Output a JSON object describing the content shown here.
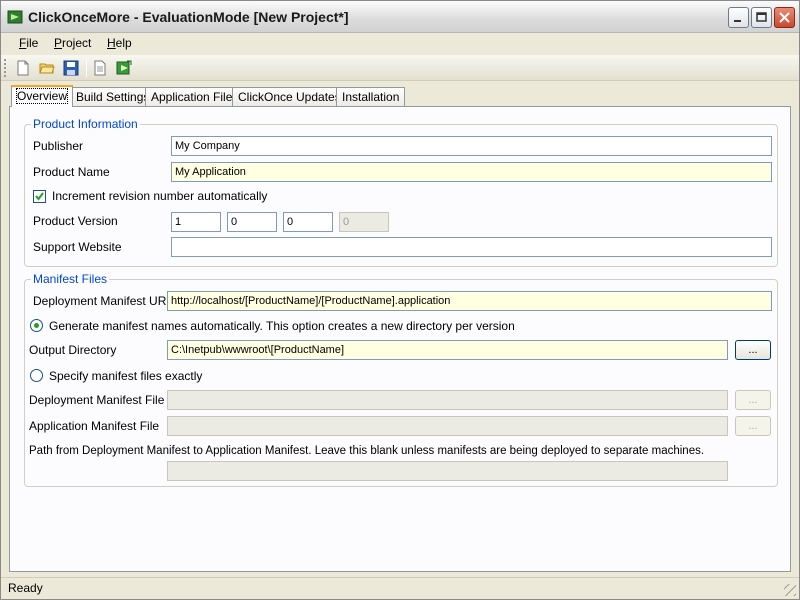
{
  "window": {
    "title": "ClickOnceMore - EvaluationMode [New Project*]",
    "icons": {
      "app": "clickonce-app-icon",
      "minimize": "minimize-icon",
      "maximize": "maximize-icon",
      "close": "close-icon"
    }
  },
  "menu": {
    "items": [
      {
        "label": "File",
        "accel": "F",
        "rest": "ile"
      },
      {
        "label": "Project",
        "accel": "P",
        "rest": "roject"
      },
      {
        "label": "Help",
        "accel": "H",
        "rest": "elp"
      }
    ]
  },
  "toolbar": {
    "icons": [
      "new-document-icon",
      "open-folder-icon",
      "save-icon",
      "page-icon",
      "build-publish-icon"
    ]
  },
  "tabs": [
    {
      "label": "Overview",
      "active": true
    },
    {
      "label": "Build Settings",
      "active": false
    },
    {
      "label": "Application Files",
      "active": false
    },
    {
      "label": "ClickOnce Updates",
      "active": false
    },
    {
      "label": "Installation",
      "active": false
    }
  ],
  "product_info": {
    "title": "Product Information",
    "publisher_label": "Publisher",
    "publisher_value": "My Company",
    "product_name_label": "Product Name",
    "product_name_value": "My Application",
    "increment_label": "Increment revision number automatically",
    "increment_checked": true,
    "version_label": "Product Version",
    "version": {
      "major": "1",
      "minor": "0",
      "build": "0",
      "revision": "0"
    },
    "support_label": "Support Website",
    "support_value": ""
  },
  "manifest": {
    "title": "Manifest Files",
    "deploy_url_label": "Deployment Manifest URL",
    "deploy_url_value": "http://localhost/[ProductName]/[ProductName].application",
    "auto_label": "Generate manifest names automatically. This option creates a new directory per version",
    "auto_selected": true,
    "output_label": "Output Directory",
    "output_value": "C:\\Inetpub\\wwwroot\\[ProductName]",
    "browse_label": "...",
    "exact_label": "Specify manifest files exactly",
    "exact_selected": false,
    "deploy_file_label": "Deployment Manifest File",
    "deploy_file_value": "",
    "app_file_label": "Application Manifest File",
    "app_file_value": "",
    "path_label": "Path from Deployment Manifest to Application Manifest. Leave this blank unless manifests are being deployed to separate machines.",
    "path_value": ""
  },
  "status": {
    "text": "Ready"
  },
  "colors": {
    "group_title": "#0046d5",
    "input_highlight": "#ffffe1",
    "accent_tab": "#f5a623"
  }
}
